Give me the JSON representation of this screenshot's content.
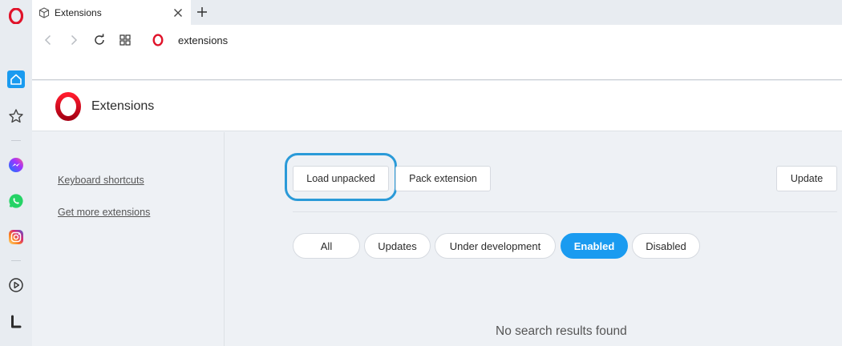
{
  "browser": {
    "tab": {
      "title": "Extensions"
    },
    "address": {
      "value": "extensions"
    },
    "colors": {
      "opera_red": "#e0132a",
      "accent_blue": "#1a9bf0",
      "highlight_ring": "#2a9ad8"
    }
  },
  "sidebar": {
    "items": [
      {
        "icon": "opera-logo-icon"
      },
      {
        "icon": "home-icon"
      },
      {
        "icon": "bookmarks-star-icon"
      },
      {
        "icon": "messenger-icon"
      },
      {
        "icon": "whatsapp-icon"
      },
      {
        "icon": "instagram-icon"
      },
      {
        "icon": "player-icon"
      },
      {
        "icon": "workspace-l-icon"
      }
    ]
  },
  "page": {
    "title": "Extensions",
    "nav": {
      "keyboard_shortcuts": "Keyboard shortcuts",
      "get_more": "Get more extensions"
    },
    "actions": {
      "load_unpacked": "Load unpacked",
      "pack_extension": "Pack extension",
      "update": "Update"
    },
    "filters": {
      "all": "All",
      "updates": "Updates",
      "under_development": "Under development",
      "enabled": "Enabled",
      "disabled": "Disabled",
      "selected": "Enabled"
    },
    "empty_message": "No search results found"
  }
}
